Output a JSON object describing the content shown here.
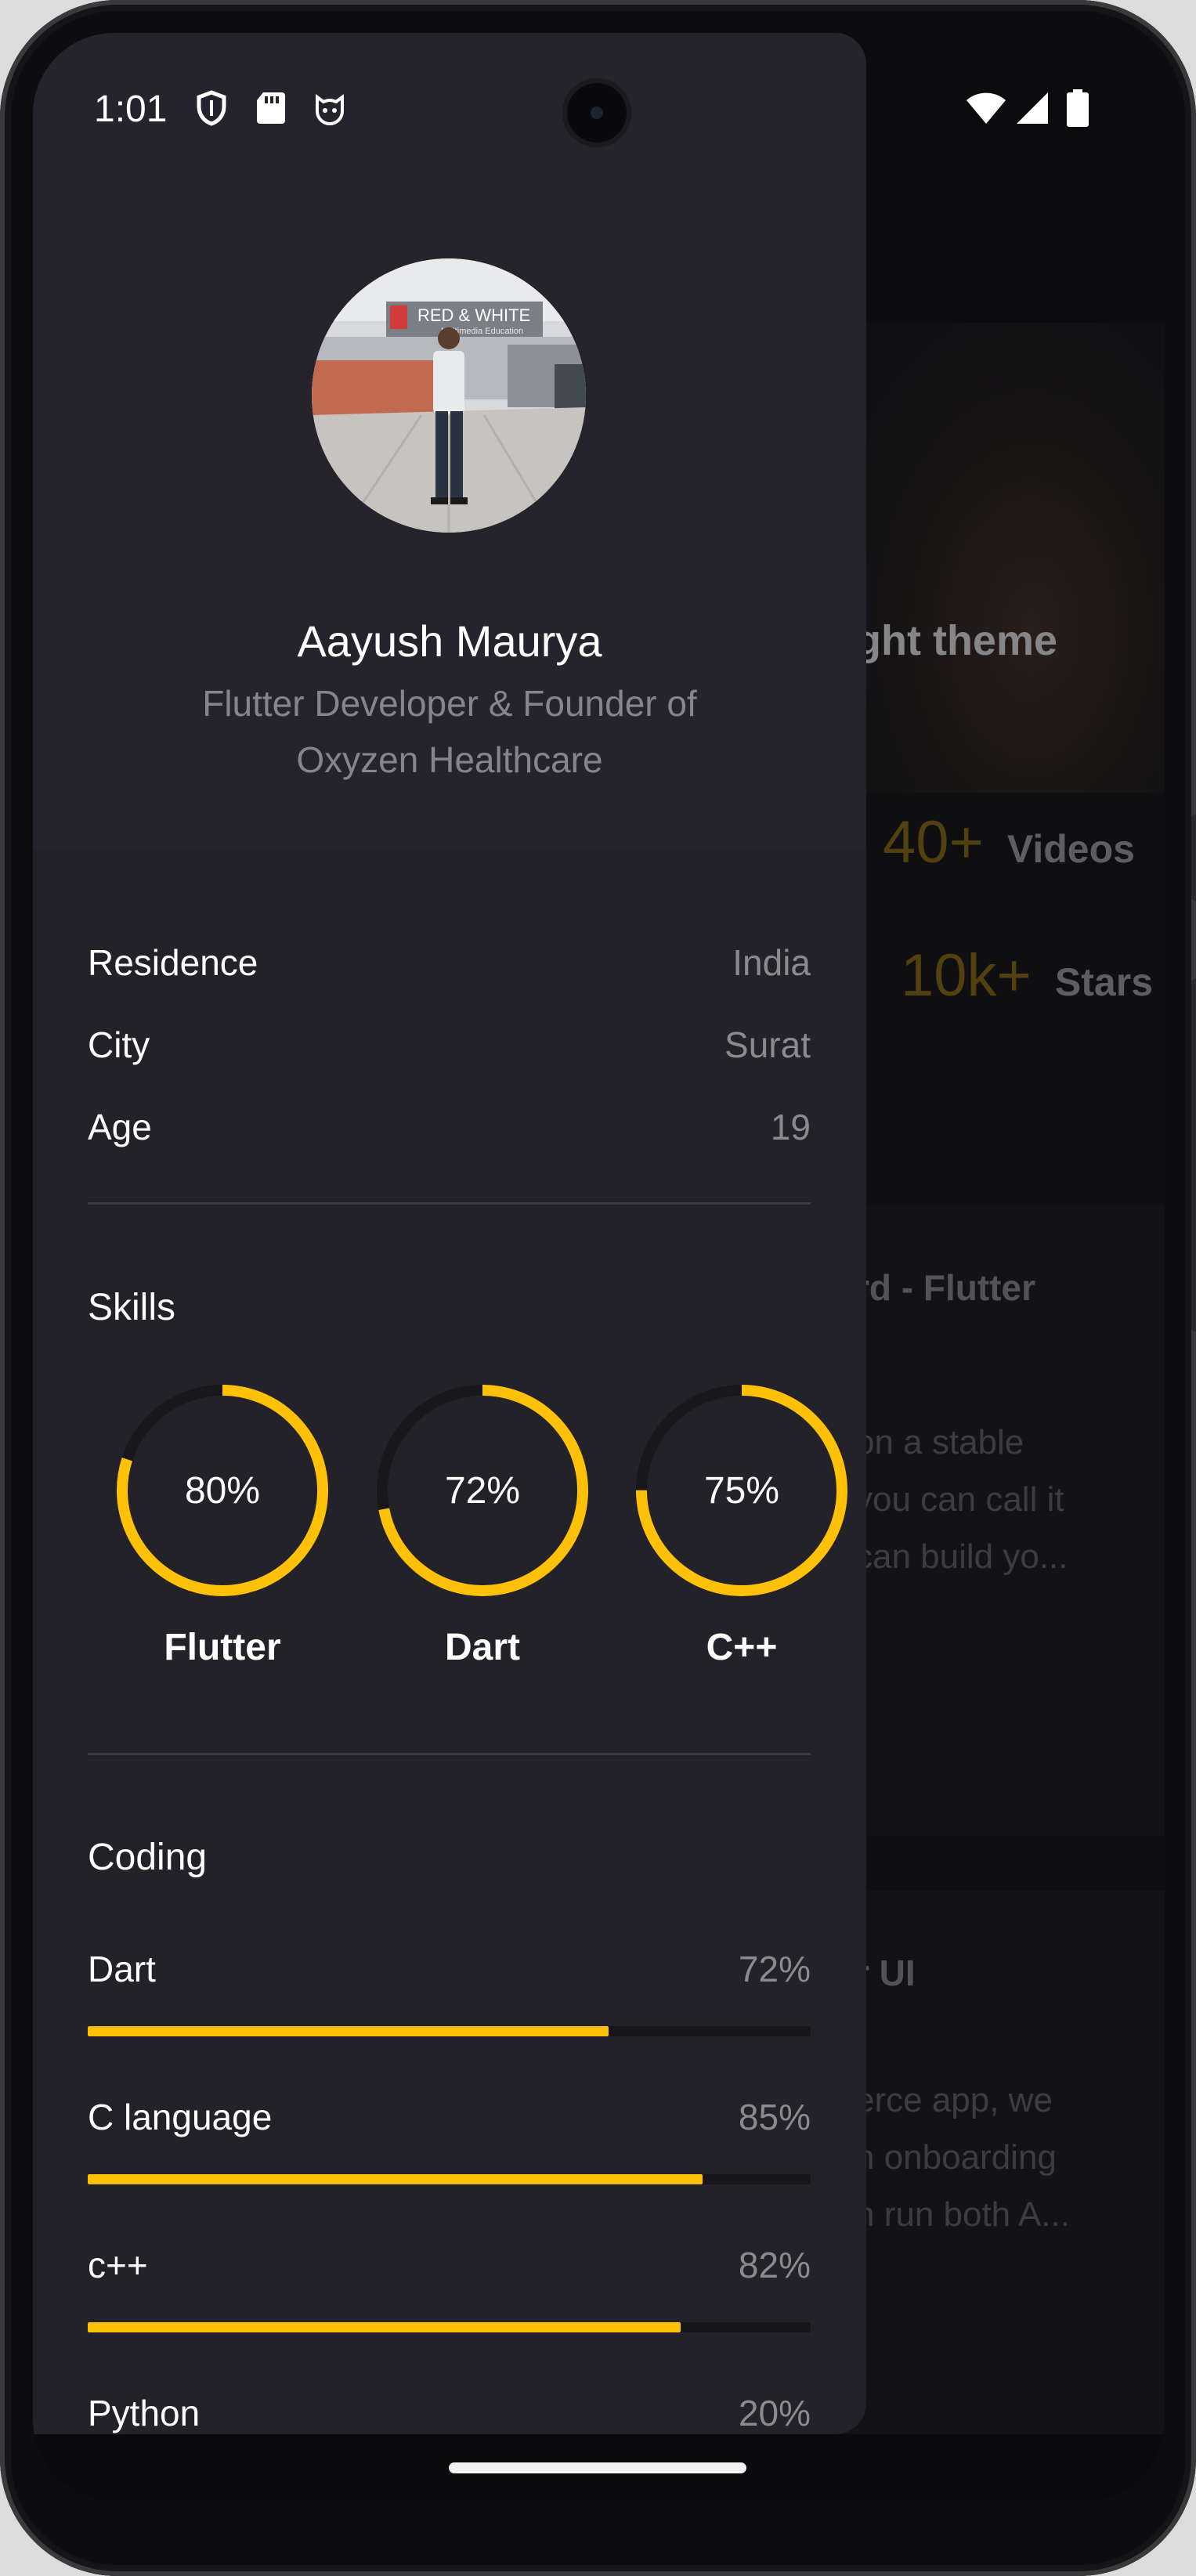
{
  "status_bar": {
    "time": "1:01",
    "left_icons": [
      "shield-icon",
      "sd-card-icon",
      "cat-face-icon"
    ],
    "right_icons": [
      "wifi-icon",
      "signal-icon",
      "battery-icon"
    ]
  },
  "profile": {
    "name": "Aayush Maurya",
    "subtitle_line1": "Flutter Developer & Founder of",
    "subtitle_line2": "Oxyzen Healthcare",
    "avatar_sign_text": "RED & WHITE",
    "avatar_sign_sub": "Multimedia Education"
  },
  "info": [
    {
      "label": "Residence",
      "value": "India"
    },
    {
      "label": "City",
      "value": "Surat"
    },
    {
      "label": "Age",
      "value": "19"
    }
  ],
  "skills": {
    "title": "Skills",
    "items": [
      {
        "name": "Flutter",
        "percent_label": "80%",
        "value": 0.8
      },
      {
        "name": "Dart",
        "percent_label": "72%",
        "value": 0.72
      },
      {
        "name": "C++",
        "percent_label": "75%",
        "value": 0.75
      }
    ]
  },
  "coding": {
    "title": "Coding",
    "items": [
      {
        "name": "Dart",
        "percent_label": "72%",
        "value": 0.72
      },
      {
        "name": "C language",
        "percent_label": "85%",
        "value": 0.85
      },
      {
        "name": "c++",
        "percent_label": "82%",
        "value": 0.82
      },
      {
        "name": "Python",
        "percent_label": "20%",
        "value": 0.2
      }
    ]
  },
  "background_page": {
    "hero_title_fragment": "ght theme",
    "stats": [
      {
        "number": "40+",
        "label": "Videos"
      },
      {
        "number": "10k+",
        "label": "Stars"
      }
    ],
    "card1_title_fragment": "rd - Flutter",
    "card1_lines": [
      "on a stable",
      "you can call it",
      "can build yo..."
    ],
    "card2_title_fragment": "r UI",
    "card2_lines": [
      "erce app, we",
      "n onboarding",
      "n run both A..."
    ]
  },
  "colors": {
    "accent": "#ffc107",
    "drawer_bg": "#222228",
    "header_bg": "#25242c",
    "text_primary": "#ffffff",
    "text_secondary": "#8a8a8f"
  }
}
